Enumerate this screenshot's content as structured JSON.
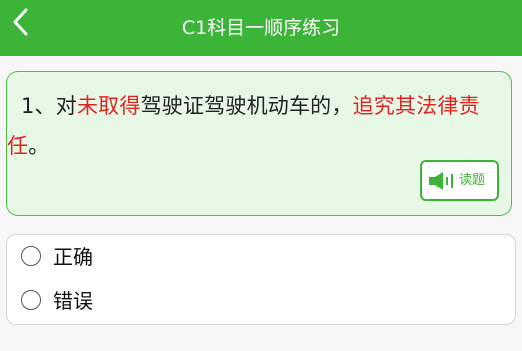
{
  "header": {
    "title": "C1科目一顺序练习",
    "back_icon": "chevron-left-icon",
    "background_color": "#3cb437"
  },
  "question": {
    "number": "1、",
    "segments": [
      {
        "text": "对",
        "highlight": false
      },
      {
        "text": "未取得",
        "highlight": true
      },
      {
        "text": "驾驶证驾驶机动车的，",
        "highlight": false
      },
      {
        "text": "追究其法律责任",
        "highlight": true
      },
      {
        "text": "。",
        "highlight": false
      }
    ],
    "highlight_color": "#e02323",
    "read_button": {
      "label": "读题",
      "icon": "speaker-icon"
    }
  },
  "options": [
    {
      "label": "正确",
      "selected": false
    },
    {
      "label": "错误",
      "selected": false
    }
  ]
}
